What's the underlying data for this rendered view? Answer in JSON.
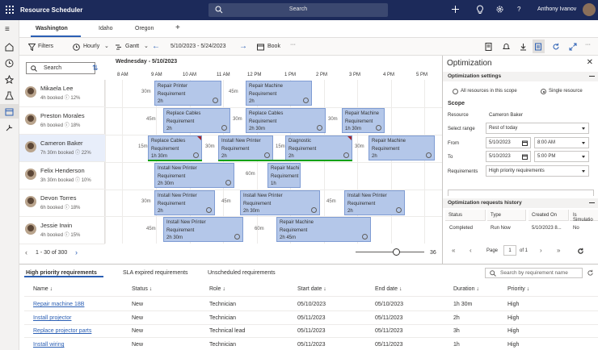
{
  "app": {
    "title": "Resource Scheduler",
    "search_placeholder": "Search",
    "user_name": "Anthony Ivanov"
  },
  "tabs": [
    {
      "label": "Washington",
      "active": true
    },
    {
      "label": "Idaho"
    },
    {
      "label": "Oregon"
    },
    {
      "label": "+"
    }
  ],
  "toolbar": {
    "filters": "Filters",
    "hourly": "Hourly",
    "gantt": "Gantt",
    "date_range": "5/10/2023 - 5/24/2023",
    "book": "Book",
    "more": "···"
  },
  "board": {
    "search_placeholder": "Search",
    "date_header": "Wednesday - 5/10/2023",
    "hours": [
      "8 AM",
      "9 AM",
      "10 AM",
      "11 AM",
      "12 PM",
      "1 PM",
      "2 PM",
      "3 PM",
      "4 PM",
      "5 PM"
    ],
    "resources": [
      {
        "name": "Mikaela Lee",
        "stats": "4h booked ⓘ 12%"
      },
      {
        "name": "Preston Morales",
        "stats": "6h booked ⓘ 18%"
      },
      {
        "name": "Cameron Baker",
        "stats": "7h 30m booked ⓘ 22%",
        "selected": true
      },
      {
        "name": "Felix Henderson",
        "stats": "3h 30m booked ⓘ 10%"
      },
      {
        "name": "Devon Torres",
        "stats": "6h booked ⓘ 18%"
      },
      {
        "name": "Jessie Irwin",
        "stats": "4h booked ⓘ 15%"
      }
    ],
    "bookings": [
      {
        "title": "Repair Printer",
        "sub": "Requirement",
        "dur": "2h"
      },
      {
        "title": "Repair Machine",
        "sub": "Requirement",
        "dur": "2h"
      },
      {
        "title": "Replace Cables",
        "sub": "Requirement",
        "dur": "2h"
      },
      {
        "title": "Replace Cables",
        "sub": "Requirement",
        "dur": "2h 30m"
      },
      {
        "title": "Repair Machine",
        "sub": "Requirement",
        "dur": "1h 30m"
      },
      {
        "title": "Replace Cables",
        "sub": "Requirement",
        "dur": "1h 30m"
      },
      {
        "title": "Install New Printer",
        "sub": "Requirement",
        "dur": "2h"
      },
      {
        "title": "Diagnostic",
        "sub": "Requirement",
        "dur": "2h"
      },
      {
        "title": "Repair Machine",
        "sub": "Requirement",
        "dur": "2h"
      },
      {
        "title": "Install New Printer",
        "sub": "Requirement",
        "dur": "2h 30m"
      },
      {
        "title": "Repair Machi",
        "sub": "Requirement",
        "dur": "1h"
      },
      {
        "title": "Install New Printer",
        "sub": "Requirement",
        "dur": "2h"
      },
      {
        "title": "Install New Printer",
        "sub": "Requirement",
        "dur": "2h 30m"
      },
      {
        "title": "Install New Printer",
        "sub": "Requirement",
        "dur": "2h"
      },
      {
        "title": "Install New Printer",
        "sub": "Requirement",
        "dur": "2h 30m"
      },
      {
        "title": "Repair Machine",
        "sub": "Requirement",
        "dur": "2h 45m"
      }
    ],
    "travel": [
      "30m",
      "45m",
      "45m",
      "30m",
      "30m",
      "15m",
      "30m",
      "15m",
      "30m",
      "60m",
      "30m",
      "45m",
      "45m",
      "45m",
      "60m"
    ],
    "pager_text": "1 - 30 of 300",
    "zoom_value": "36"
  },
  "optimization": {
    "title": "Optimization",
    "settings_header": "Optimization settings",
    "radio_all": "All resources in this scope",
    "radio_single": "Single resource",
    "scope_label": "Scope",
    "resource_label": "Resource",
    "resource_value": "Cameron Baker",
    "select_range_label": "Select range",
    "select_range_value": "Rest of today",
    "from_label": "From",
    "from_date": "5/10/2023",
    "from_time": "8:00 AM",
    "to_label": "To",
    "to_date": "5/10/2023",
    "to_time": "5:00 PM",
    "requirements_label": "Requirements",
    "requirements_value": "High priority requirements",
    "history_header": "Optimization requests history",
    "history_cols": [
      "Status",
      "Type",
      "Created On",
      "Is Simulatio"
    ],
    "history_row": [
      "Completed",
      "Run Now",
      "5/10/2023 8...",
      "No"
    ],
    "page_label": "Page",
    "page_value": "1",
    "of_label": "of 1"
  },
  "requirements": {
    "tabs": [
      "High priority requirements",
      "SLA expired requirements",
      "Unscheduled requirements"
    ],
    "search_placeholder": "Search by requirement name",
    "columns": [
      "Name ↓",
      "Status ↓",
      "Role ↓",
      "Start date ↓",
      "End date ↓",
      "Duration ↓",
      "Priority ↓"
    ],
    "rows": [
      [
        "Repair machine 18B",
        "New",
        "Technician",
        "05/10/2023",
        "05/10/2023",
        "1h 30m",
        "High"
      ],
      [
        "Install projector",
        "New",
        "Technician",
        "05/11/2023",
        "05/11/2023",
        "2h",
        "High"
      ],
      [
        "Replace projector parts",
        "New",
        "Technical lead",
        "05/11/2023",
        "05/11/2023",
        "3h",
        "High"
      ],
      [
        "Install wiring",
        "New",
        "Technician",
        "05/11/2023",
        "05/11/2023",
        "1h",
        "High"
      ]
    ]
  }
}
